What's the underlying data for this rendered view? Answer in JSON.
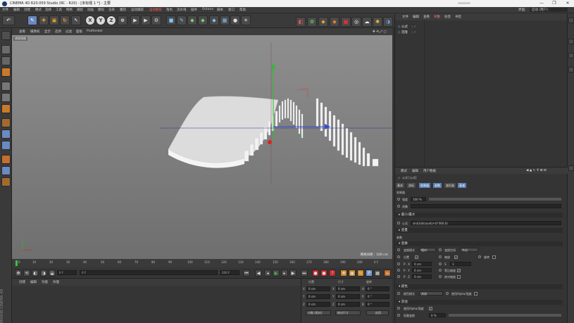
{
  "window": {
    "title": "CINEMA 4D R20.059 Studio (RC - R20) - [未标题 1 *] - 主要"
  },
  "menubar": {
    "items": [
      "文件",
      "编辑",
      "创建",
      "模式",
      "选择",
      "工具",
      "网格",
      "捕捉",
      "动画",
      "模拟",
      "渲染",
      "雕刻",
      "运动跟踪",
      "运动图形",
      "角色",
      "流水线",
      "插件",
      "Octane",
      "脚本",
      "窗口",
      "帮助"
    ],
    "right_label": "界面:",
    "layout_value": "启动 (用户)"
  },
  "viewport": {
    "menu": [
      "查看",
      "摄像机",
      "显示",
      "选项",
      "过滤",
      "面板",
      "ProRender"
    ],
    "view_name": "透视视图",
    "grid_spacing": "网格间距 : 100 cm"
  },
  "timeline": {
    "ticks": [
      "0",
      "10",
      "20",
      "30",
      "40",
      "50",
      "60",
      "70",
      "80",
      "90",
      "100",
      "110",
      "120",
      "130",
      "140",
      "150",
      "160",
      "170",
      "180",
      "190",
      "200"
    ],
    "end_frame": "0 F"
  },
  "playbar": {
    "current": "0 F",
    "start": "0 F",
    "end": "200 F",
    "end2": "200 F"
  },
  "material": {
    "tabs": [
      "创建",
      "编辑",
      "功能",
      "纹理"
    ]
  },
  "coordinates": {
    "col_headers": [
      "位置",
      "尺寸",
      "旋转"
    ],
    "rows": [
      [
        "X",
        "0 cm",
        "X",
        "0 cm",
        "H",
        "0 °"
      ],
      [
        "Y",
        "0 cm",
        "Y",
        "0 cm",
        "P",
        "0 °"
      ],
      [
        "Z",
        "0 cm",
        "Z",
        "0 cm",
        "B",
        "0 °"
      ]
    ],
    "mode1": "对象 (相对)",
    "mode2": "绝对尺寸",
    "apply": "应用"
  },
  "object_manager": {
    "menu": [
      "文件",
      "编辑",
      "查看",
      "对象",
      "标签",
      "书签"
    ],
    "objects": [
      "公式",
      "克隆"
    ]
  },
  "attribute_manager": {
    "menu": [
      "模式",
      "编辑",
      "用户数据"
    ],
    "object_title": "公式 [公式]",
    "tabs": [
      "基本",
      "坐标",
      "效果器",
      "参数",
      "变形器",
      "衰减"
    ],
    "effector_header": "效果器",
    "strength_label": "强度",
    "strength_value": "100 %",
    "select_label": "选集",
    "min_max_label": "最小/最大",
    "formula_label": "公式",
    "formula_value": "sin(((id/count)+t)*360.0)",
    "var_label": "变量",
    "params_header": "参数",
    "transform_header": "变换",
    "transform_mode_label": "变换模式",
    "transform_mode_value": "相对",
    "transform_space_label": "变换空间",
    "transform_space_value": "节点",
    "pos_label": "位置",
    "scale_label": "缩放",
    "rot_label": "旋转",
    "px_label": "P . X",
    "px_value": "0 cm",
    "py_label": "P . Y",
    "pz_label": "P . Z",
    "sx_label": "S",
    "sx_value": "1",
    "uniform_label": "等比缩放",
    "abs_label": "绝对缩放",
    "color_header": "颜色",
    "color_mode_label": "颜色模式",
    "color_mode_value": "关闭",
    "use_alpha_label": "使用Alpha/强度",
    "other_header": "其他",
    "weight_label": "使用Alpha/强度",
    "weight_trans_label": "权重变换",
    "weight_value": "0 %"
  }
}
